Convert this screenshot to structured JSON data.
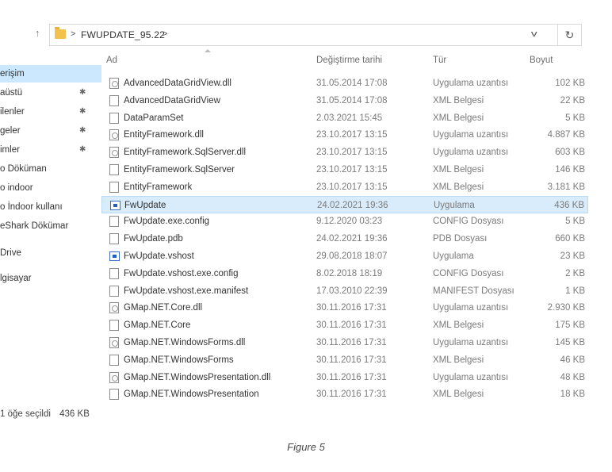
{
  "nav": {
    "up_arrow": "↑",
    "folder_name": "FWUPDATE_95.22",
    "crumb_sep": ">",
    "dropdown_glyph": "v",
    "refresh_glyph": "↻"
  },
  "sidebar": {
    "items": [
      {
        "label": "erişim",
        "pinned": false,
        "active": true
      },
      {
        "label": "aüstü",
        "pinned": true
      },
      {
        "label": "ilenler",
        "pinned": true
      },
      {
        "label": "geler",
        "pinned": true
      },
      {
        "label": "imler",
        "pinned": true
      },
      {
        "label": "o Döküman",
        "pinned": false
      },
      {
        "label": "o indoor",
        "pinned": false
      },
      {
        "label": "o İndoor kullanı",
        "pinned": false
      },
      {
        "label": "eShark Dökümar",
        "pinned": false
      },
      {
        "label": "Drive",
        "pinned": false
      },
      {
        "label": "lgisayar",
        "pinned": false
      }
    ],
    "pin_glyph": "✱"
  },
  "columns": {
    "name": "Ad",
    "date": "Değiştirme tarihi",
    "type": "Tür",
    "size": "Boyut"
  },
  "files": [
    {
      "name": "AdvancedDataGridView.dll",
      "date": "31.05.2014 17:08",
      "type": "Uygulama uzantısı",
      "size": "102 KB",
      "icon": "dll"
    },
    {
      "name": "AdvancedDataGridView",
      "date": "31.05.2014 17:08",
      "type": "XML Belgesi",
      "size": "22 KB",
      "icon": "doc"
    },
    {
      "name": "DataParamSet",
      "date": "2.03.2021 15:45",
      "type": "XML Belgesi",
      "size": "5 KB",
      "icon": "doc"
    },
    {
      "name": "EntityFramework.dll",
      "date": "23.10.2017 13:15",
      "type": "Uygulama uzantısı",
      "size": "4.887 KB",
      "icon": "dll"
    },
    {
      "name": "EntityFramework.SqlServer.dll",
      "date": "23.10.2017 13:15",
      "type": "Uygulama uzantısı",
      "size": "603 KB",
      "icon": "dll"
    },
    {
      "name": "EntityFramework.SqlServer",
      "date": "23.10.2017 13:15",
      "type": "XML Belgesi",
      "size": "146 KB",
      "icon": "doc"
    },
    {
      "name": "EntityFramework",
      "date": "23.10.2017 13:15",
      "type": "XML Belgesi",
      "size": "3.181 KB",
      "icon": "doc"
    },
    {
      "name": "FwUpdate",
      "date": "24.02.2021 19:36",
      "type": "Uygulama",
      "size": "436 KB",
      "icon": "exe",
      "selected": true
    },
    {
      "name": "FwUpdate.exe.config",
      "date": "9.12.2020 03:23",
      "type": "CONFIG Dosyası",
      "size": "5 KB",
      "icon": "doc"
    },
    {
      "name": "FwUpdate.pdb",
      "date": "24.02.2021 19:36",
      "type": "PDB Dosyası",
      "size": "660 KB",
      "icon": "doc"
    },
    {
      "name": "FwUpdate.vshost",
      "date": "29.08.2018 18:07",
      "type": "Uygulama",
      "size": "23 KB",
      "icon": "exe"
    },
    {
      "name": "FwUpdate.vshost.exe.config",
      "date": "8.02.2018 18:19",
      "type": "CONFIG Dosyası",
      "size": "2 KB",
      "icon": "doc"
    },
    {
      "name": "FwUpdate.vshost.exe.manifest",
      "date": "17.03.2010 22:39",
      "type": "MANIFEST Dosyası",
      "size": "1 KB",
      "icon": "doc"
    },
    {
      "name": "GMap.NET.Core.dll",
      "date": "30.11.2016 17:31",
      "type": "Uygulama uzantısı",
      "size": "2.930 KB",
      "icon": "dll"
    },
    {
      "name": "GMap.NET.Core",
      "date": "30.11.2016 17:31",
      "type": "XML Belgesi",
      "size": "175 KB",
      "icon": "doc"
    },
    {
      "name": "GMap.NET.WindowsForms.dll",
      "date": "30.11.2016 17:31",
      "type": "Uygulama uzantısı",
      "size": "145 KB",
      "icon": "dll"
    },
    {
      "name": "GMap.NET.WindowsForms",
      "date": "30.11.2016 17:31",
      "type": "XML Belgesi",
      "size": "46 KB",
      "icon": "doc"
    },
    {
      "name": "GMap.NET.WindowsPresentation.dll",
      "date": "30.11.2016 17:31",
      "type": "Uygulama uzantısı",
      "size": "48 KB",
      "icon": "dll"
    },
    {
      "name": "GMap.NET.WindowsPresentation",
      "date": "30.11.2016 17:31",
      "type": "XML Belgesi",
      "size": "18 KB",
      "icon": "doc"
    }
  ],
  "status": {
    "selection_text": "1 öğe seçildi",
    "selection_size": "436 KB"
  },
  "caption": "Figure 5",
  "colors": {
    "selected_row_bg": "#d9ecfb",
    "active_nav_bg": "#cce8ff",
    "folder_icon": "#f2c14e"
  }
}
